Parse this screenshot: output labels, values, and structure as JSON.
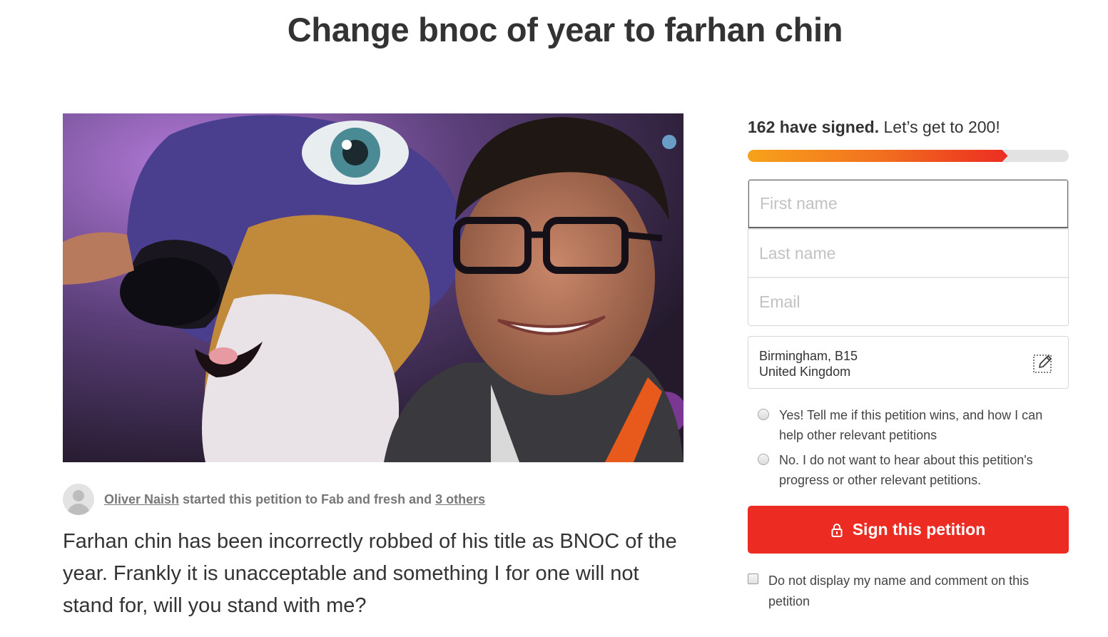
{
  "petition": {
    "title": "Change bnoc of year to farhan chin",
    "starter_name": "Oliver Naish",
    "starter_middle": " started this petition to Fab and fresh and ",
    "others_link": "3 others",
    "description": "Farhan chin has been incorrectly robbed of his title as BNOC of the year. Frankly it is unacceptable and something I for one will not stand for, will you stand with me?"
  },
  "signatures": {
    "count_text": "162 have signed.",
    "goal_text": "Let’s get to 200!",
    "signed": 162,
    "goal": 200,
    "progress_fraction": 0.81
  },
  "form": {
    "first_name_placeholder": "First name",
    "last_name_placeholder": "Last name",
    "email_placeholder": "Email",
    "location_line1": "Birmingham, B15",
    "location_line2": "United Kingdom",
    "opt_in_label": "Yes! Tell me if this petition wins, and how I can help other relevant petitions",
    "opt_out_label": "No. I do not want to hear about this petition's progress or other relevant petitions.",
    "sign_button_label": "Sign this petition",
    "hide_name_label": "Do not display my name and comment on this petition"
  },
  "colors": {
    "brand_red": "#ec2c22",
    "progress_start": "#f7a21a",
    "progress_end": "#ec2c22",
    "text": "#333333"
  },
  "icons": {
    "location_edit": "pencil-edit-icon",
    "sign_button": "lock-icon",
    "avatar": "user-avatar-icon"
  }
}
